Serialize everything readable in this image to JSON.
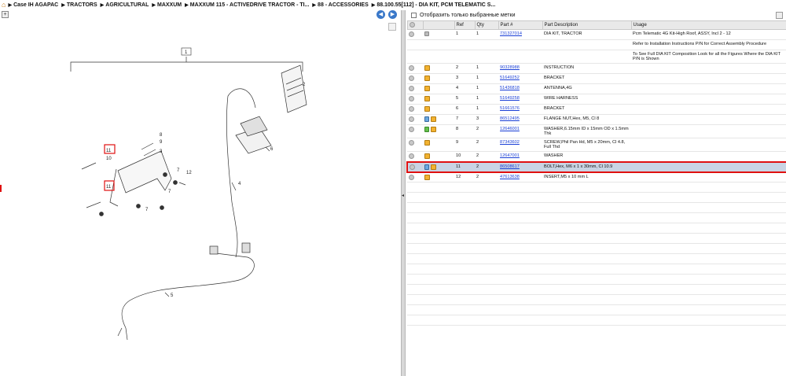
{
  "breadcrumb": [
    "Case IH AGAPAC",
    "TRACTORS",
    "AGRICULTURAL",
    "MAXXUM",
    "MAXXUM 115 - ACTIVEDRIVE TRACTOR - TI...",
    "88 - ACCESSORIES",
    "88.100.55[112] - DIA KIT, PCM TELEMATIC S..."
  ],
  "filter_label": "Отобразить только выбранные метки",
  "table": {
    "headers": [
      "Ref",
      "Qty",
      "Part #",
      "Part Description",
      "Usage"
    ],
    "rows": [
      {
        "icons": [
          "circle",
          "wrench"
        ],
        "ref": "1",
        "qty": "1",
        "part": "731327014",
        "desc": "DIA KIT, TRACTOR",
        "usage": "Pcm Telematic 4G Kit-High Roof, ASSY, Incl 2 - 12"
      },
      {
        "icons": [],
        "ref": "",
        "qty": "",
        "part": "",
        "desc": "",
        "usage": "Refer to Installation Instructions P/N for Correct Assembly Procedure"
      },
      {
        "icons": [],
        "ref": "",
        "qty": "",
        "part": "",
        "desc": "",
        "usage": "To See Full DIA KIT Composition Look for all the Figures Where the DIA KIT P/N is Shown"
      },
      {
        "icons": [
          "circle",
          "box"
        ],
        "ref": "2",
        "qty": "1",
        "part": "90328988",
        "desc": "INSTRUCTION",
        "usage": ""
      },
      {
        "icons": [
          "circle",
          "box"
        ],
        "ref": "3",
        "qty": "1",
        "part": "51649252",
        "desc": "BRACKET",
        "usage": ""
      },
      {
        "icons": [
          "circle",
          "box"
        ],
        "ref": "4",
        "qty": "1",
        "part": "51436818",
        "desc": "ANTENNA,4G",
        "usage": ""
      },
      {
        "icons": [
          "circle",
          "box"
        ],
        "ref": "5",
        "qty": "1",
        "part": "51649258",
        "desc": "WIRE HARNESS",
        "usage": ""
      },
      {
        "icons": [
          "circle",
          "box"
        ],
        "ref": "6",
        "qty": "1",
        "part": "51661576",
        "desc": "BRACKET",
        "usage": ""
      },
      {
        "icons": [
          "circle",
          "swap",
          "box"
        ],
        "ref": "7",
        "qty": "3",
        "part": "86512495",
        "desc": "FLANGE NUT,Hex, M5, Cl 8",
        "usage": ""
      },
      {
        "icons": [
          "circle",
          "greenarrow",
          "box"
        ],
        "ref": "8",
        "qty": "2",
        "part": "12646001",
        "desc": "WASHER,6.15mm ID x 15mm OD x 1.5mm Thk",
        "usage": ""
      },
      {
        "icons": [
          "circle",
          "box"
        ],
        "ref": "9",
        "qty": "2",
        "part": "87343602",
        "desc": "SCREW,Phil Pan Hd, M5 x 20mm, Cl 4.8, Full Thd",
        "usage": ""
      },
      {
        "icons": [
          "circle",
          "box"
        ],
        "ref": "10",
        "qty": "2",
        "part": "12647001",
        "desc": "WASHER",
        "usage": ""
      },
      {
        "icons": [
          "circle",
          "swap",
          "box"
        ],
        "ref": "11",
        "qty": "2",
        "part": "86508617",
        "desc": "BOLT,Hex, M6 x 1 x 30mm, Cl 10.9",
        "usage": "",
        "selected": true
      },
      {
        "icons": [
          "circle",
          "box"
        ],
        "ref": "12",
        "qty": "2",
        "part": "47613638",
        "desc": "INSERT,M5 x 10 mm L",
        "usage": ""
      }
    ]
  },
  "diagram": {
    "callouts": [
      "1",
      "2",
      "3",
      "4",
      "5",
      "6",
      "7",
      "7",
      "7",
      "8",
      "9",
      "10",
      "11",
      "11",
      "12"
    ]
  }
}
